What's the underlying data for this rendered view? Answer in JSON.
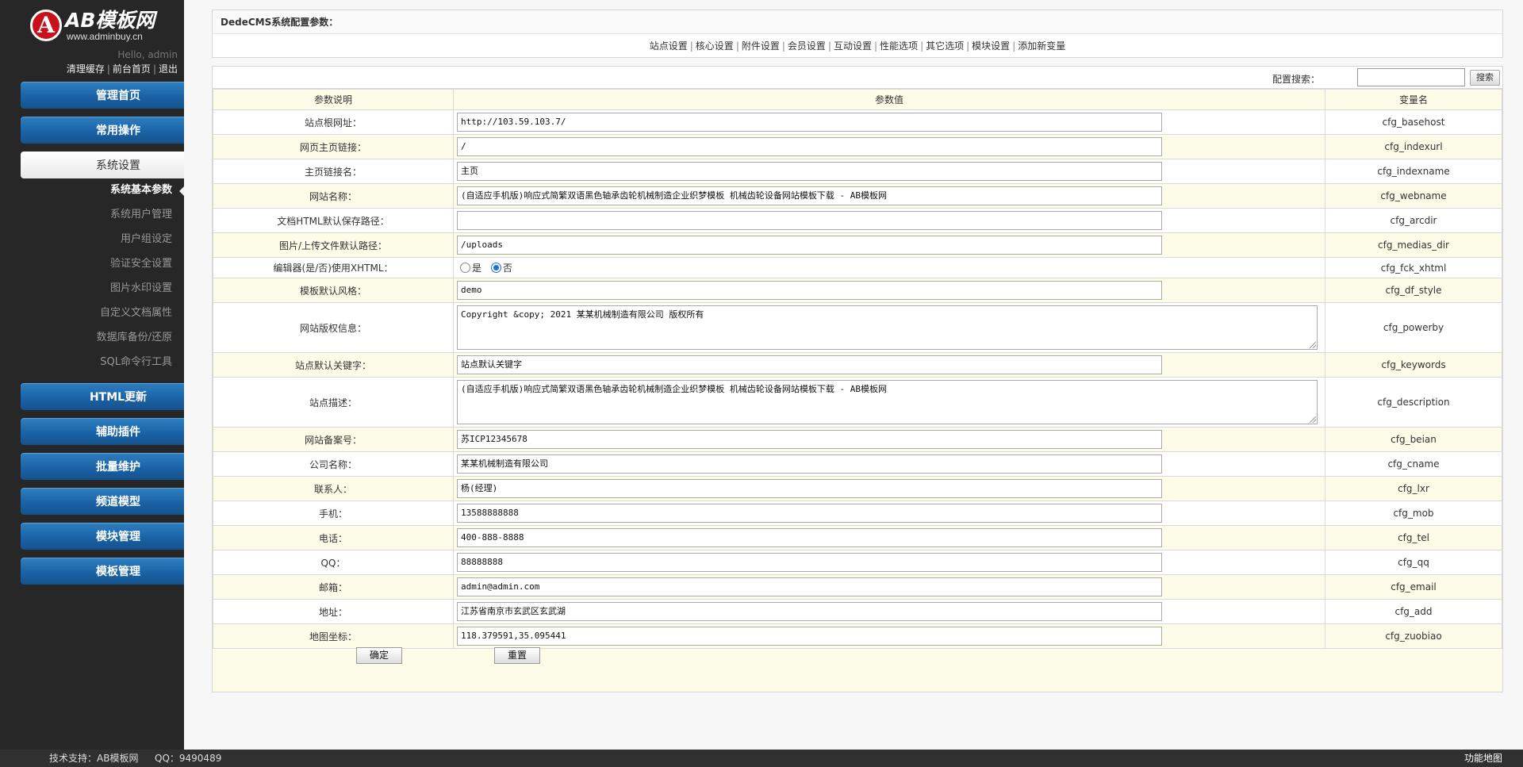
{
  "sidebar": {
    "logo_mark": "A",
    "brand": "AB模板网",
    "domain": "www.adminbuy.cn",
    "hello": "Hello, admin",
    "links": [
      "清理缓存",
      "前台首页",
      "退出"
    ],
    "nav": [
      {
        "label": "管理首页"
      },
      {
        "label": "常用操作"
      },
      {
        "label": "系统设置"
      },
      {
        "label": "HTML更新"
      },
      {
        "label": "辅助插件"
      },
      {
        "label": "批量维护"
      },
      {
        "label": "频道模型"
      },
      {
        "label": "模块管理"
      },
      {
        "label": "模板管理"
      }
    ],
    "sub_items": [
      "系统基本参数",
      "系统用户管理",
      "用户组设定",
      "验证安全设置",
      "图片水印设置",
      "自定义文档属性",
      "数据库备份/还原",
      "SQL命令行工具"
    ]
  },
  "header": {
    "title": "DedeCMS系统配置参数：",
    "tabs": [
      "站点设置",
      "核心设置",
      "附件设置",
      "会员设置",
      "互动设置",
      "性能选项",
      "其它选项",
      "模块设置",
      "添加新变量"
    ]
  },
  "search": {
    "label": "配置搜索：",
    "value": "",
    "button": "搜索"
  },
  "table": {
    "headers": [
      "参数说明",
      "参数值",
      "变量名"
    ],
    "rows": [
      {
        "label": "站点根网址：",
        "value": "http://103.59.103.7/",
        "var": "cfg_basehost"
      },
      {
        "label": "网页主页链接：",
        "value": "/",
        "var": "cfg_indexurl"
      },
      {
        "label": "主页链接名：",
        "value": "主页",
        "var": "cfg_indexname"
      },
      {
        "label": "网站名称：",
        "value": "(自适应手机版)响应式简繁双语黑色轴承齿轮机械制造企业织梦模板 机械齿轮设备网站模板下载 - AB模板网",
        "var": "cfg_webname"
      },
      {
        "label": "文档HTML默认保存路径：",
        "value": "",
        "var": "cfg_arcdir"
      },
      {
        "label": "图片/上传文件默认路径：",
        "value": "/uploads",
        "var": "cfg_medias_dir"
      },
      {
        "label": "编辑器(是/否)使用XHTML：",
        "radio": [
          "是",
          "否"
        ],
        "selected": "否",
        "var": "cfg_fck_xhtml"
      },
      {
        "label": "模板默认风格：",
        "value": "demo",
        "var": "cfg_df_style"
      },
      {
        "label": "网站版权信息：",
        "value": "Copyright &copy; 2021 某某机械制造有限公司 版权所有",
        "var": "cfg_powerby",
        "multiline": true
      },
      {
        "label": "站点默认关键字：",
        "value": "站点默认关键字",
        "var": "cfg_keywords"
      },
      {
        "label": "站点描述：",
        "value": "(自适应手机版)响应式简繁双语黑色轴承齿轮机械制造企业织梦模板 机械齿轮设备网站模板下载 - AB模板网",
        "var": "cfg_description",
        "multiline": true
      },
      {
        "label": "网站备案号：",
        "value": "苏ICP12345678",
        "var": "cfg_beian"
      },
      {
        "label": "公司名称：",
        "value": "某某机械制造有限公司",
        "var": "cfg_cname"
      },
      {
        "label": "联系人：",
        "value": "杨(经理)",
        "var": "cfg_lxr"
      },
      {
        "label": "手机：",
        "value": "13588888888",
        "var": "cfg_mob"
      },
      {
        "label": "电话：",
        "value": "400-888-8888",
        "var": "cfg_tel"
      },
      {
        "label": "QQ：",
        "value": "88888888",
        "var": "cfg_qq"
      },
      {
        "label": "邮箱：",
        "value": "admin@admin.com",
        "var": "cfg_email"
      },
      {
        "label": "地址：",
        "value": "江苏省南京市玄武区玄武湖",
        "var": "cfg_add"
      },
      {
        "label": "地图坐标：",
        "value": "118.379591,35.095441",
        "var": "cfg_zuobiao"
      }
    ]
  },
  "actions": {
    "confirm": "确定",
    "reset": "重置"
  },
  "footer": {
    "support": "技术支持：AB模板网",
    "qq": "QQ：9490489",
    "sitemap": "功能地图"
  }
}
